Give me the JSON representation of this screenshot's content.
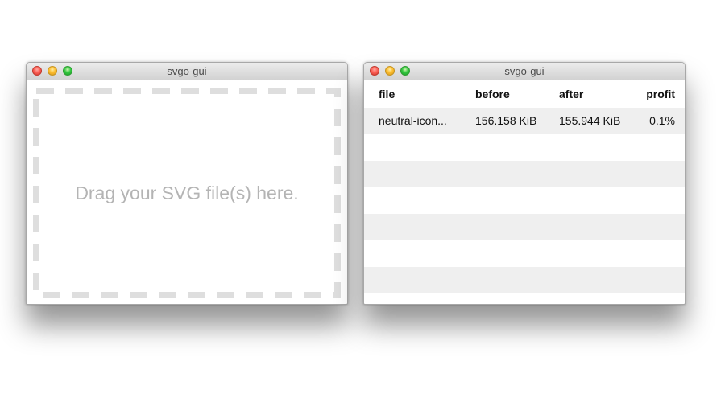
{
  "left_window": {
    "title": "svgo-gui",
    "drop_text": "Drag your SVG file(s) here."
  },
  "right_window": {
    "title": "svgo-gui",
    "table": {
      "columns": [
        "file",
        "before",
        "after",
        "profit"
      ],
      "rows": [
        {
          "file": "neutral-icon...",
          "before": "156.158 KiB",
          "after": "155.944 KiB",
          "profit": "0.1%"
        }
      ]
    }
  },
  "colors": {
    "close_button": "#fc6056",
    "minimize_button": "#fdbd2e",
    "zoom_button": "#33c840",
    "drop_border": "#dedede",
    "drop_text": "#b4b4b4",
    "stripe": "#efefef"
  },
  "icons": {
    "close": "close-dot-icon",
    "minimize": "minimize-dot-icon",
    "zoom": "zoom-dot-icon"
  }
}
